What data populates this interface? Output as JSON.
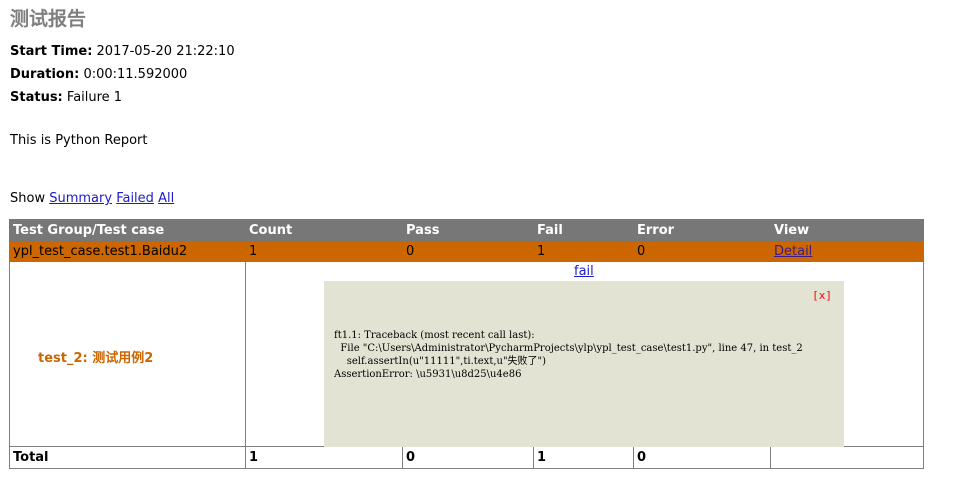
{
  "heading": "测试报告",
  "attributes": {
    "start_time_label": "Start Time:",
    "start_time": "2017-05-20 21:22:10",
    "duration_label": "Duration:",
    "duration": "0:00:11.592000",
    "status_label": "Status:",
    "status": "Failure 1"
  },
  "description": "This is Python Report",
  "show": {
    "label": "Show",
    "summary": "Summary",
    "failed": "Failed",
    "all": "All"
  },
  "table": {
    "headers": [
      "Test Group/Test case",
      "Count",
      "Pass",
      "Fail",
      "Error",
      "View"
    ],
    "group": {
      "name": "ypl_test_case.test1.Baidu2",
      "count": "1",
      "pass": "0",
      "fail": "1",
      "error": "0",
      "view": "Detail"
    },
    "case": {
      "name": "test_2: 测试用例2",
      "status_link": "fail",
      "close": "[x]",
      "traceback": "ft1.1: Traceback (most recent call last):\n  File \"C:\\Users\\Administrator\\PycharmProjects\\ylp\\ypl_test_case\\test1.py\", line 47, in test_2\n    self.assertIn(u\"11111\",ti.text,u\"失败了\")\nAssertionError: \\u5931\\u8d25\\u4e86"
    },
    "total": {
      "label": "Total",
      "count": "1",
      "pass": "0",
      "fail": "1",
      "error": "0"
    }
  },
  "colors": {
    "header_bg": "#777777",
    "group_bg": "#cc6600",
    "popup_bg": "#e3e3d3",
    "heading": "#7f7f7f"
  }
}
